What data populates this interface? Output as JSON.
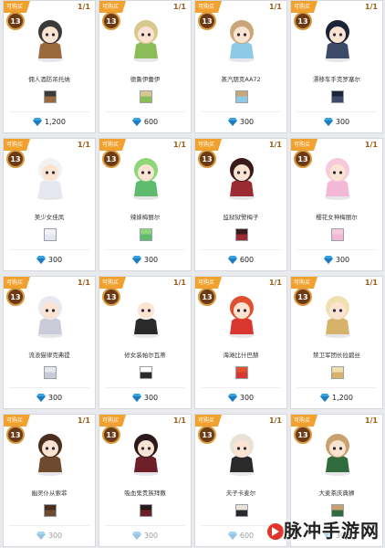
{
  "stock_label": "1/1",
  "level": "13",
  "ribbon_label": "可购买",
  "items": [
    {
      "name": "佣人酒防吊托纳",
      "price": "1,200",
      "accent": "#9a6a3c",
      "hair": "#3a3a3a"
    },
    {
      "name": "德鲁伊蕾伊",
      "price": "600",
      "accent": "#8cbc5a",
      "hair": "#d8c890"
    },
    {
      "name": "蒸汽朋克AA72",
      "price": "300",
      "accent": "#8ec9e6",
      "hair": "#c9a67a"
    },
    {
      "name": "漂移车手克罗塞尔",
      "price": "300",
      "accent": "#3d4a6a",
      "hair": "#1c2438"
    },
    {
      "name": "美少女佳凤",
      "price": "300",
      "accent": "#e6e6f0",
      "hair": "#f2f2f2"
    },
    {
      "name": "辣妹梅丽尔",
      "price": "300",
      "accent": "#5dbb6e",
      "hair": "#8fd67a"
    },
    {
      "name": "监狱狱警梅子",
      "price": "600",
      "accent": "#9c2a32",
      "hair": "#3a1a1a"
    },
    {
      "name": "樱花女神梅丽尔",
      "price": "300",
      "accent": "#f2b8d6",
      "hair": "#f7c9dc"
    },
    {
      "name": "流浪猫律克弗提",
      "price": "300",
      "accent": "#c9ccd8",
      "hair": "#e8e8ee"
    },
    {
      "name": "修女装帕尔瓦蒂",
      "price": "300",
      "accent": "#2a2a2a",
      "hair": "#ffffff"
    },
    {
      "name": "海滩比什巴赫",
      "price": "300",
      "accent": "#d8362e",
      "hair": "#e05030"
    },
    {
      "name": "禁卫军团长拉碧丝",
      "price": "1,200",
      "accent": "#d7b26a",
      "hair": "#f0e0b0"
    },
    {
      "name": "幽灵仆从索菲",
      "price": "300",
      "accent": "#6e4a2e",
      "hair": "#4a2e1e"
    },
    {
      "name": "吸血鬼贵族拜撒",
      "price": "300",
      "accent": "#6e2028",
      "hair": "#2a1a1a"
    },
    {
      "name": "夫子卡麦尔",
      "price": "600",
      "accent": "#2a2a2a",
      "hair": "#e8e2d8"
    },
    {
      "name": "大麦茶庆典狮",
      "price": "300",
      "accent": "#2f6b3c",
      "hair": "#c9a070"
    }
  ],
  "watermark": {
    "text": "脉冲手游网"
  }
}
